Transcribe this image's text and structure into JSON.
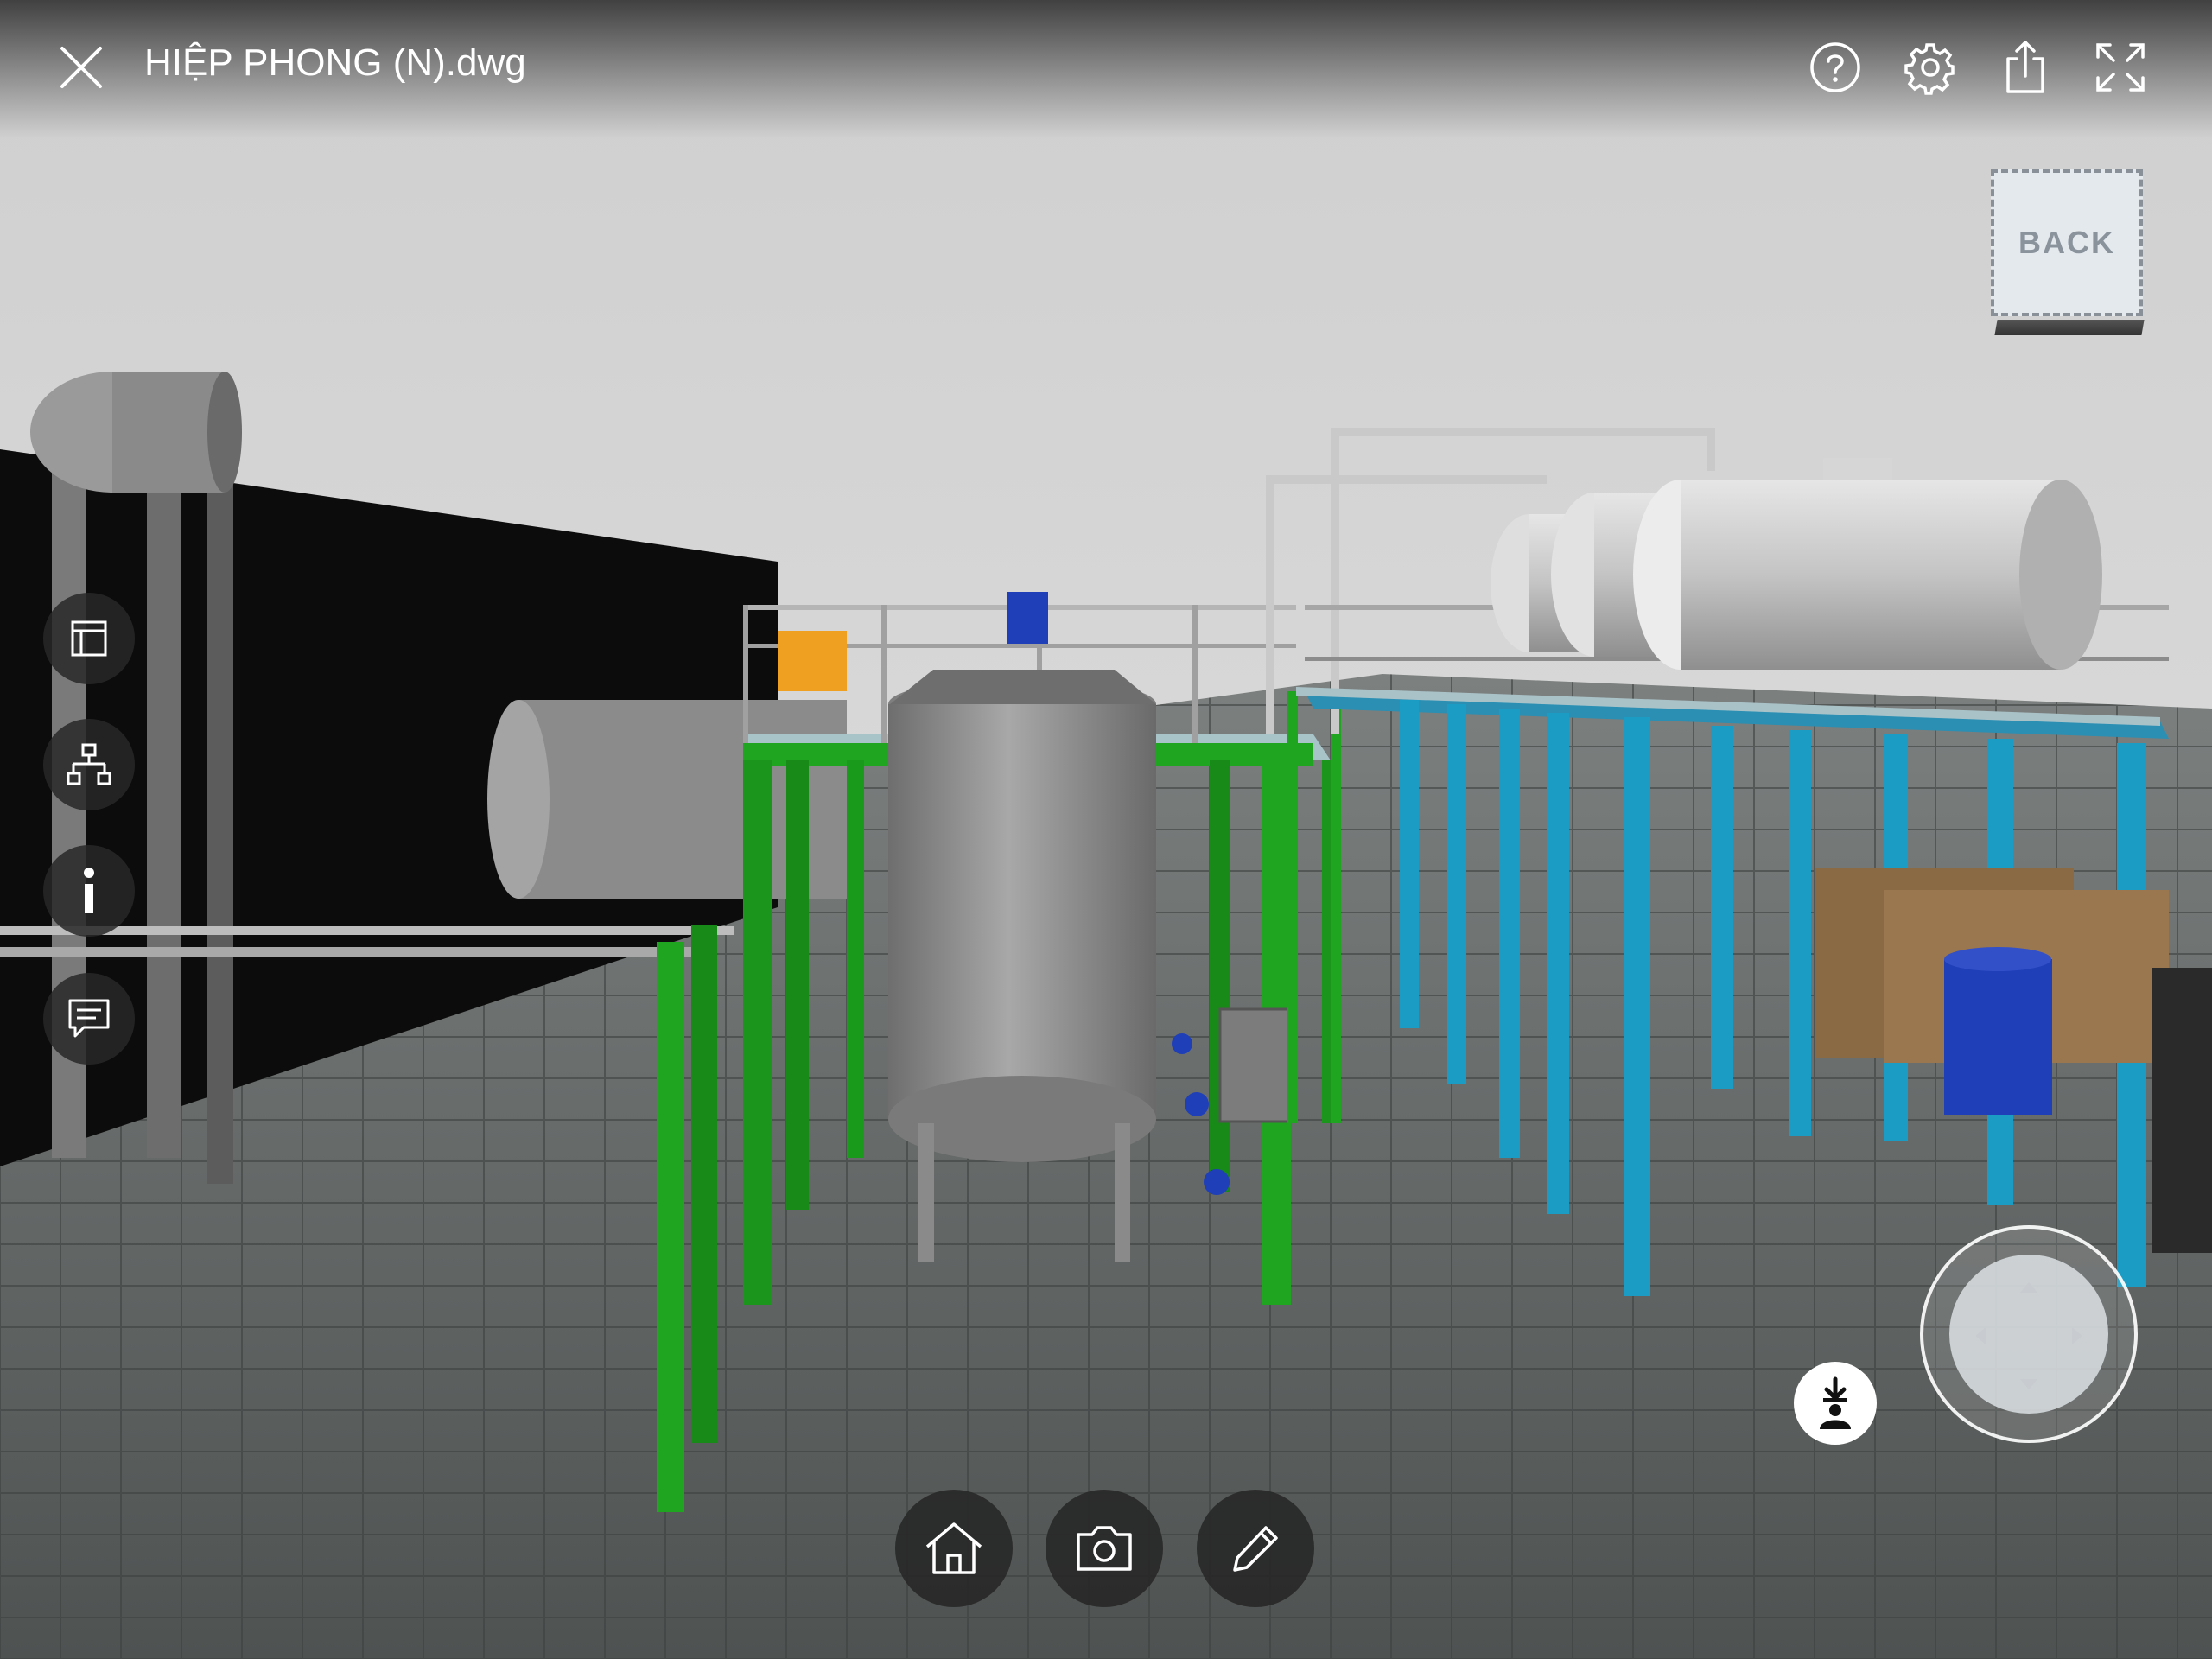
{
  "header": {
    "file_name": "HIỆP PHONG (N).dwg",
    "close_icon": "close-icon",
    "help_icon": "help-icon",
    "settings_icon": "gear-icon",
    "share_icon": "share-icon",
    "fullscreen_icon": "fullscreen-icon"
  },
  "view_cube": {
    "face_label": "BACK"
  },
  "side_toolbar": [
    {
      "name": "sheets-button",
      "icon": "layout-icon"
    },
    {
      "name": "model-browser-button",
      "icon": "hierarchy-icon"
    },
    {
      "name": "properties-button",
      "icon": "info-icon"
    },
    {
      "name": "comments-button",
      "icon": "comment-icon"
    }
  ],
  "bottom_toolbar": [
    {
      "name": "home-button",
      "icon": "home-icon"
    },
    {
      "name": "snapshot-button",
      "icon": "camera-icon"
    },
    {
      "name": "markup-button",
      "icon": "pencil-icon"
    }
  ],
  "navigation": {
    "first_person_icon": "first-person-icon",
    "joystick": "navigation-joystick"
  },
  "colors": {
    "frame_green": "#1fa51f",
    "frame_cyan": "#1a9cc4",
    "tank_gray": "#8d8d8d",
    "floor": "#5e6261",
    "background": "#d9d9d9"
  }
}
